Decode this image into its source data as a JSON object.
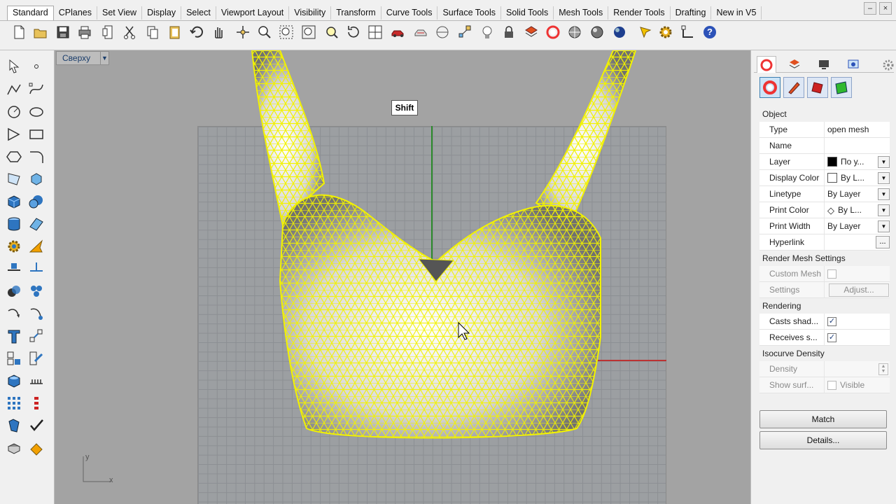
{
  "tabs": [
    {
      "label": "Standard",
      "active": true
    },
    {
      "label": "CPlanes"
    },
    {
      "label": "Set View"
    },
    {
      "label": "Display"
    },
    {
      "label": "Select"
    },
    {
      "label": "Viewport Layout"
    },
    {
      "label": "Visibility"
    },
    {
      "label": "Transform"
    },
    {
      "label": "Curve Tools"
    },
    {
      "label": "Surface Tools"
    },
    {
      "label": "Solid Tools"
    },
    {
      "label": "Mesh Tools"
    },
    {
      "label": "Render Tools"
    },
    {
      "label": "Drafting"
    },
    {
      "label": "New in V5"
    }
  ],
  "toolbar_icons": [
    "new-icon",
    "open-icon",
    "save-icon",
    "print-icon",
    "import-icon",
    "cut-icon",
    "copy-icon",
    "paste-icon",
    "undo-icon",
    "pan-icon",
    "move-icon",
    "zoom-icon",
    "zoom-window-icon",
    "zoom-extents-icon",
    "zoom-selected-icon",
    "rotate-view-icon",
    "four-viewports-icon",
    "car-icon",
    "toggle-icon",
    "cplane-icon",
    "select-points-icon",
    "light-icon",
    "lock-icon",
    "layer-icon",
    "color-icon",
    "shaded-sphere-icon",
    "rendered-sphere-icon",
    "blue-sphere-icon",
    "highlight-icon",
    "options-icon",
    "snap-icon",
    "help-icon"
  ],
  "viewport": {
    "title": "Сверху",
    "tooltip": "Shift",
    "axis_x": "x",
    "axis_y": "y"
  },
  "panel": {
    "sections": {
      "object": "Object",
      "render_mesh": "Render Mesh Settings",
      "rendering": "Rendering",
      "isocurve": "Isocurve Density"
    },
    "object_rows": [
      {
        "key": "Type",
        "value": "open mesh"
      },
      {
        "key": "Name",
        "value": ""
      },
      {
        "key": "Layer",
        "value": "По у..."
      },
      {
        "key": "Display Color",
        "value": "By L..."
      },
      {
        "key": "Linetype",
        "value": "By Layer"
      },
      {
        "key": "Print Color",
        "value": "By L..."
      },
      {
        "key": "Print Width",
        "value": "By Layer"
      },
      {
        "key": "Hyperlink",
        "value": ""
      }
    ],
    "hyperlink_btn": "...",
    "custom_mesh": "Custom Mesh",
    "settings": "Settings",
    "adjust": "Adjust...",
    "casts": "Casts shad...",
    "receives": "Receives s...",
    "density": "Density",
    "show_surf": "Show surf...",
    "visible": "Visible",
    "match": "Match",
    "details": "Details...",
    "colors": {
      "layer_swatch": "#000000",
      "mesh_wire": "#f2f200",
      "accent": "#3c7fb1"
    }
  }
}
